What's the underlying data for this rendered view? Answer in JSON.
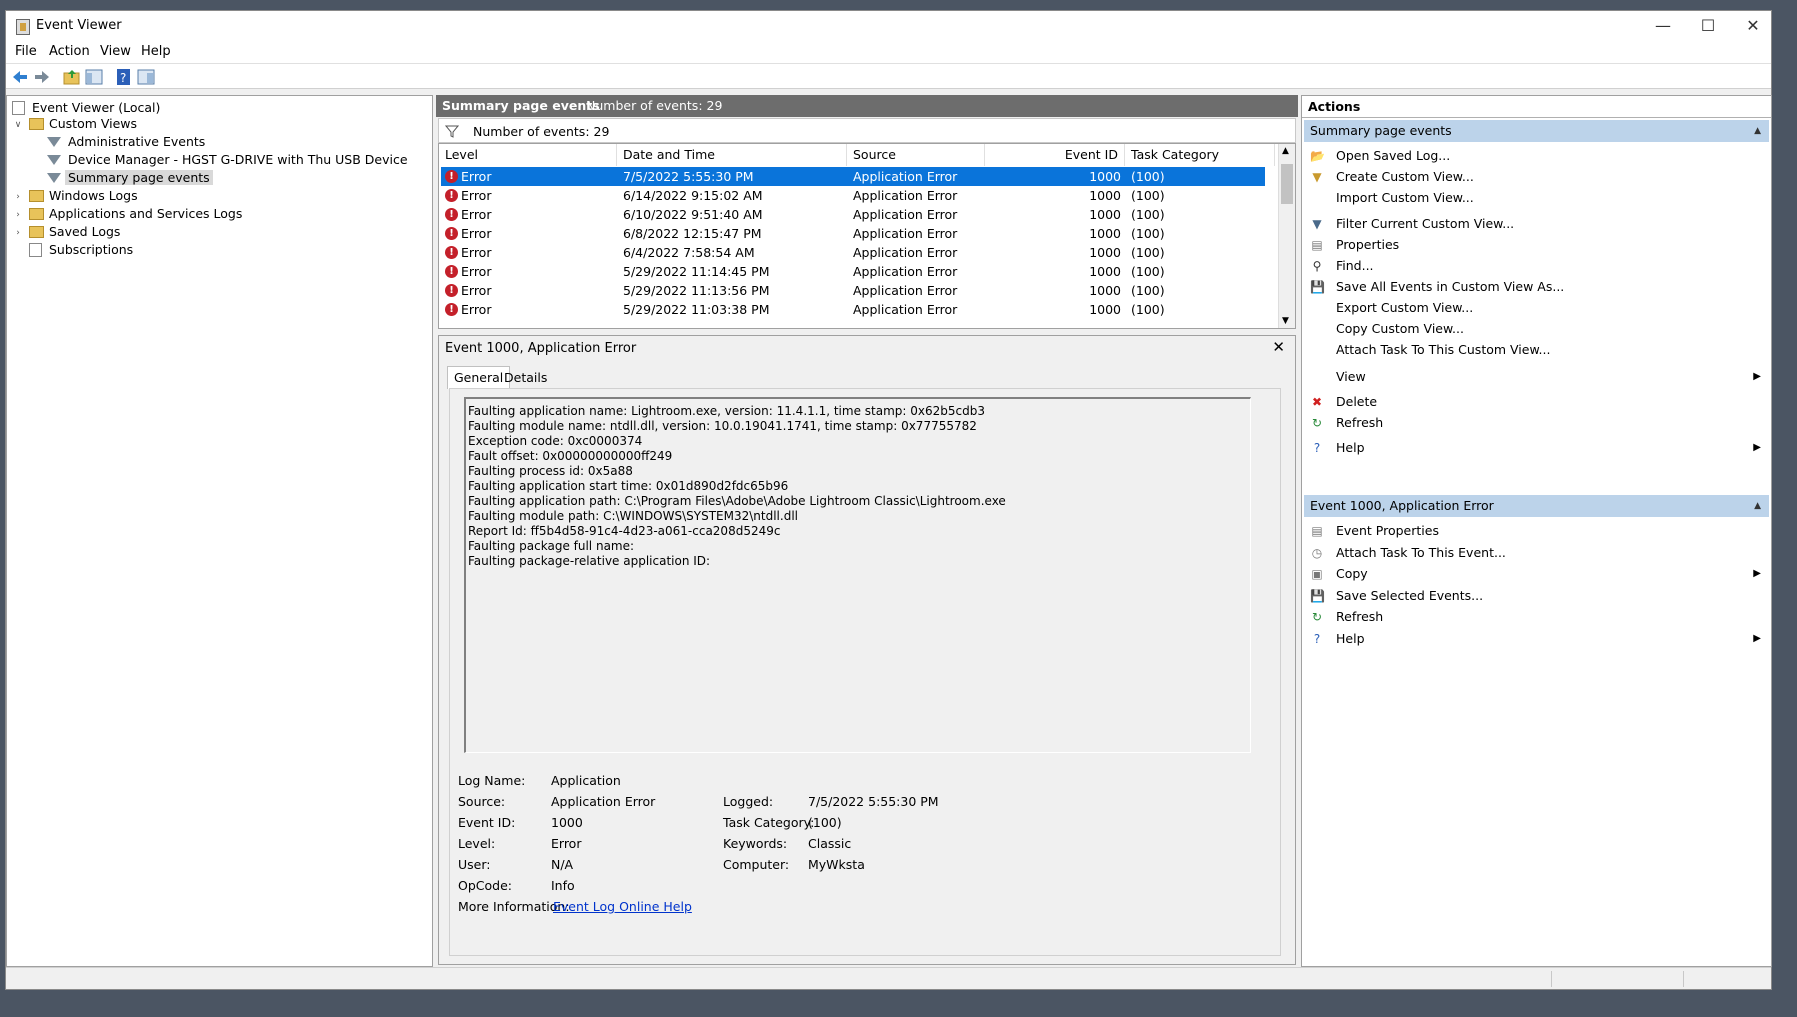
{
  "window": {
    "title": "Event Viewer"
  },
  "menu": [
    "File",
    "Action",
    "View",
    "Help"
  ],
  "tree": {
    "root": "Event Viewer (Local)",
    "custom_views": "Custom Views",
    "admin_events": "Administrative Events",
    "device_manager": "Device Manager - HGST G-DRIVE with Thu USB Device",
    "summary_page_events": "Summary page events",
    "windows_logs": "Windows Logs",
    "app_services_logs": "Applications and Services Logs",
    "saved_logs": "Saved Logs",
    "subscriptions": "Subscriptions"
  },
  "middle": {
    "header_title": "Summary page events",
    "header_count": "Number of events: 29",
    "filter_count": "Number of events: 29",
    "columns": [
      "Level",
      "Date and Time",
      "Source",
      "Event ID",
      "Task Category"
    ],
    "rows": [
      {
        "level": "Error",
        "date": "7/5/2022 5:55:30 PM",
        "source": "Application Error",
        "id": "1000",
        "cat": "(100)"
      },
      {
        "level": "Error",
        "date": "6/14/2022 9:15:02 AM",
        "source": "Application Error",
        "id": "1000",
        "cat": "(100)"
      },
      {
        "level": "Error",
        "date": "6/10/2022 9:51:40 AM",
        "source": "Application Error",
        "id": "1000",
        "cat": "(100)"
      },
      {
        "level": "Error",
        "date": "6/8/2022 12:15:47 PM",
        "source": "Application Error",
        "id": "1000",
        "cat": "(100)"
      },
      {
        "level": "Error",
        "date": "6/4/2022 7:58:54 AM",
        "source": "Application Error",
        "id": "1000",
        "cat": "(100)"
      },
      {
        "level": "Error",
        "date": "5/29/2022 11:14:45 PM",
        "source": "Application Error",
        "id": "1000",
        "cat": "(100)"
      },
      {
        "level": "Error",
        "date": "5/29/2022 11:13:56 PM",
        "source": "Application Error",
        "id": "1000",
        "cat": "(100)"
      },
      {
        "level": "Error",
        "date": "5/29/2022 11:03:38 PM",
        "source": "Application Error",
        "id": "1000",
        "cat": "(100)"
      }
    ]
  },
  "detail": {
    "title": "Event 1000, Application Error",
    "tabs": [
      "General",
      "Details"
    ],
    "description": [
      "Faulting application name: Lightroom.exe, version: 11.4.1.1, time stamp: 0x62b5cdb3",
      "Faulting module name: ntdll.dll, version: 10.0.19041.1741, time stamp: 0x77755782",
      "Exception code: 0xc0000374",
      "Fault offset: 0x00000000000ff249",
      "Faulting process id: 0x5a88",
      "Faulting application start time: 0x01d890d2fdc65b96",
      "Faulting application path: C:\\Program Files\\Adobe\\Adobe Lightroom Classic\\Lightroom.exe",
      "Faulting module path: C:\\WINDOWS\\SYSTEM32\\ntdll.dll",
      "Report Id: ff5b4d58-91c4-4d23-a061-cca208d5249c",
      "Faulting package full name:",
      "Faulting package-relative application ID:"
    ],
    "log_name_label": "Log Name:",
    "log_name": "Application",
    "source_label": "Source:",
    "source": "Application Error",
    "logged_label": "Logged:",
    "logged": "7/5/2022 5:55:30 PM",
    "event_id_label": "Event ID:",
    "event_id": "1000",
    "task_category_label": "Task Category:",
    "task_category": "(100)",
    "level_label": "Level:",
    "level": "Error",
    "keywords_label": "Keywords:",
    "keywords": "Classic",
    "user_label": "User:",
    "user": "N/A",
    "computer_label": "Computer:",
    "computer": "MyWksta",
    "opcode_label": "OpCode:",
    "opcode": "Info",
    "more_info_label": "More Information:",
    "more_info_link": "Event Log Online Help"
  },
  "actions": {
    "title": "Actions",
    "section1": "Summary page events",
    "section1_items": [
      "Open Saved Log...",
      "Create Custom View...",
      "Import Custom View...",
      "Filter Current Custom View...",
      "Properties",
      "Find...",
      "Save All Events in Custom View As...",
      "Export Custom View...",
      "Copy Custom View...",
      "Attach Task To This Custom View...",
      "View",
      "Delete",
      "Refresh",
      "Help"
    ],
    "section2": "Event 1000, Application Error",
    "section2_items": [
      "Event Properties",
      "Attach Task To This Event...",
      "Copy",
      "Save Selected Events...",
      "Refresh",
      "Help"
    ]
  },
  "colors": {
    "selection": "#0a74da",
    "section_header": "#bcd3ea",
    "error_icon": "#c4202a",
    "link": "#0033cc"
  }
}
